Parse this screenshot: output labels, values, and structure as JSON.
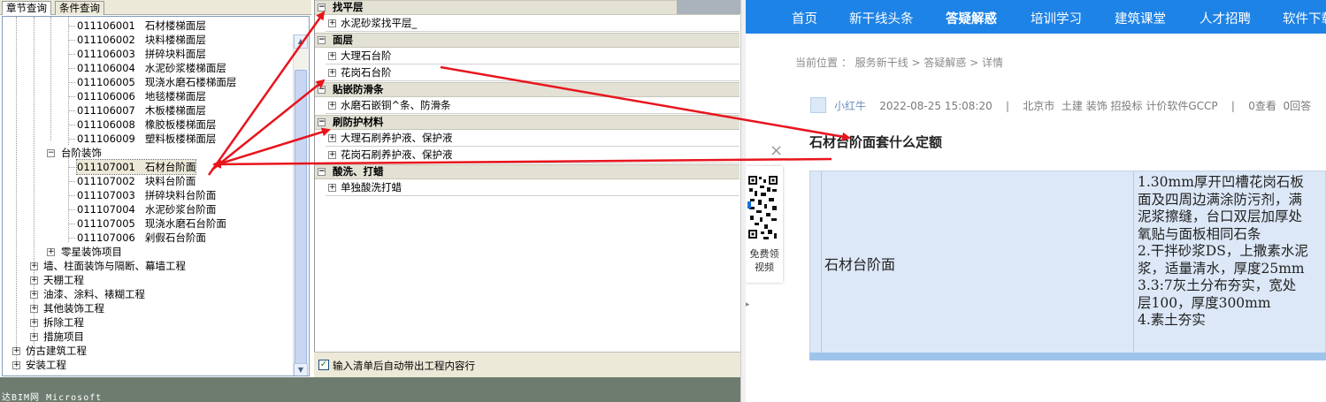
{
  "left_panel": {
    "tabs": [
      "章节查询",
      "条件查询"
    ],
    "tree": [
      {
        "code": "011106001",
        "name": "石材楼梯面层"
      },
      {
        "code": "011106002",
        "name": "块料楼梯面层"
      },
      {
        "code": "011106003",
        "name": "拼碎块料面层"
      },
      {
        "code": "011106004",
        "name": "水泥砂浆楼梯面层"
      },
      {
        "code": "011106005",
        "name": "现浇水磨石楼梯面层"
      },
      {
        "code": "011106006",
        "name": "地毯楼梯面层"
      },
      {
        "code": "011106007",
        "name": "木板楼梯面层"
      },
      {
        "code": "011106008",
        "name": "橡胶板楼梯面层"
      },
      {
        "code": "011106009",
        "name": "塑料板楼梯面层"
      }
    ],
    "group_label": "台阶装饰",
    "group_items": [
      {
        "code": "011107001",
        "name": "石材台阶面"
      },
      {
        "code": "011107002",
        "name": "块料台阶面"
      },
      {
        "code": "011107003",
        "name": "拼碎块料台阶面"
      },
      {
        "code": "011107004",
        "name": "水泥砂浆台阶面"
      },
      {
        "code": "011107005",
        "name": "现浇水磨石台阶面"
      },
      {
        "code": "011107006",
        "name": "剁假石台阶面"
      }
    ],
    "sibling_label": "零星装饰项目",
    "sections": [
      "墙、柱面装饰与隔断、幕墙工程",
      "天棚工程",
      "油漆、涂料、裱糊工程",
      "其他装饰工程",
      "拆除工程",
      "措施项目"
    ],
    "roots": [
      "仿古建筑工程",
      "安装工程"
    ]
  },
  "middle_panel": {
    "categories": [
      {
        "title": "找平层",
        "rows": [
          "水泥砂浆找平层_"
        ]
      },
      {
        "title": "面层",
        "rows": [
          "大理石台阶",
          "花岗石台阶"
        ]
      },
      {
        "title": "贴嵌防滑条",
        "rows": [
          "水磨石嵌铜^条、防滑条"
        ]
      },
      {
        "title": "刷防护材料",
        "rows": [
          "大理石刷养护液、保护液",
          "花岗石刷养护液、保护液"
        ]
      },
      {
        "title": "酸洗、打蜡",
        "rows": [
          "单独酸洗打蜡"
        ]
      }
    ],
    "checkbox_label": "输入清单后自动带出工程内容行"
  },
  "bottom_strip_text": "达BIM网   Microsoft",
  "web": {
    "nav": [
      "首页",
      "新干线头条",
      "答疑解惑",
      "培训学习",
      "建筑课堂",
      "人才招聘",
      "软件下载"
    ],
    "active_nav": "答疑解惑",
    "breadcrumb": "当前位置 ： 服务新干线 > 答疑解惑 > 详情",
    "user": "小红牛",
    "datetime": "2022-08-25 15:08:20",
    "location_tags": "北京市  土建 装饰 招投标 计价软件GCCP",
    "views": "0查看",
    "answers": "0回答",
    "question_title": "石材台阶面套什么定额",
    "close_symbol": "×",
    "qr_text": "免费领\n视频",
    "table": {
      "item": "石材台阶面",
      "content": "1.30mm厚开凹槽花岗石板\n面及四周边满涂防污剂，满\n泥浆擦缝，台口双层加厚处\n氧贴与面板相同石条\n2.干拌砂浆DS，上撒素水泥\n浆，适量清水，厚度25mm\n3.3:7灰土分布夯实，宽处\n层100，厚度300mm\n4.素土夯实"
    }
  },
  "colors": {
    "nav_bg": "#1e83e6",
    "arrow": "#e8141c",
    "table_bg": "#dce8f7"
  }
}
